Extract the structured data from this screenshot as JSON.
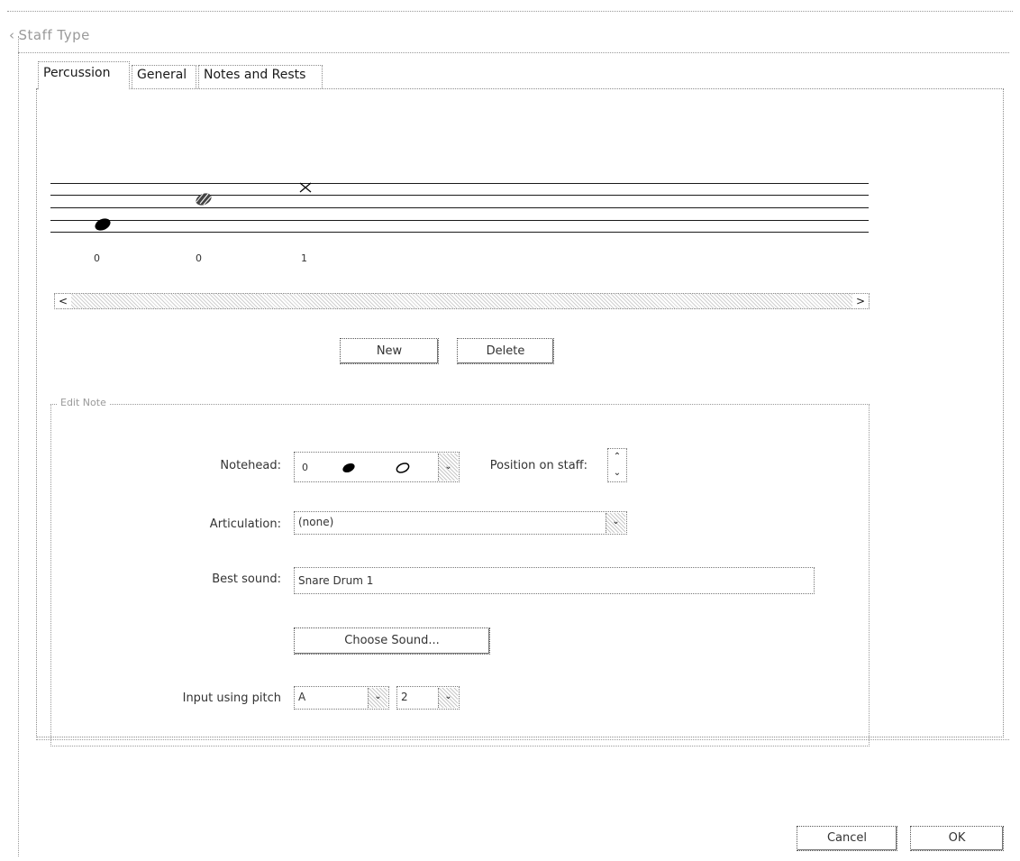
{
  "window": {
    "title": "Staff Type"
  },
  "tabs": [
    {
      "label": "Percussion"
    },
    {
      "label": "General"
    },
    {
      "label": "Notes and Rests"
    }
  ],
  "preview": {
    "note_labels": [
      "0",
      "0",
      "1"
    ]
  },
  "buttons": {
    "new": "New",
    "delete": "Delete",
    "choose_sound": "Choose Sound...",
    "cancel": "Cancel",
    "ok": "OK"
  },
  "edit_note": {
    "group_label": "Edit Note",
    "notehead_label": "Notehead:",
    "notehead_value_index": "0",
    "position_label": "Position on staff:",
    "articulation_label": "Articulation:",
    "articulation_value": "(none)",
    "best_sound_label": "Best sound:",
    "best_sound_value": "Snare Drum 1",
    "input_pitch_label": "Input using pitch",
    "pitch_note": "A",
    "pitch_octave": "2"
  },
  "icons": {
    "scroll_left": "chevron-left-icon",
    "scroll_right": "chevron-right-icon",
    "dropdown": "chevron-down-icon",
    "spinner": "up-down-arrows-icon"
  }
}
